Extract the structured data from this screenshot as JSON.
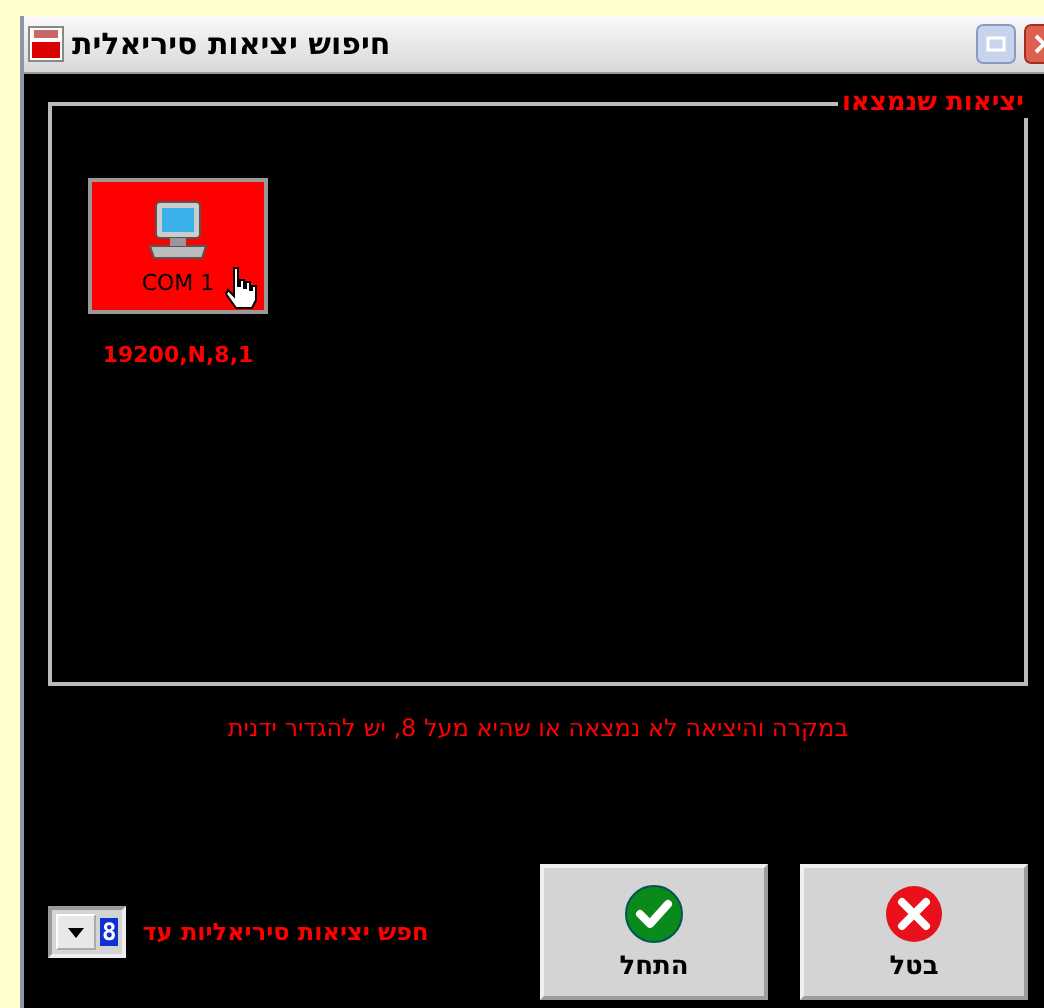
{
  "window": {
    "title": "חיפוש יציאות סיריאלית"
  },
  "found_ports": {
    "legend": "יציאות שנמצאו",
    "ports": [
      {
        "name": "COM 1",
        "settings": "19200,N,8,1",
        "selected": true
      }
    ]
  },
  "message": "במקרה והיציאה לא נמצאה או שהיא מעל 8, יש להגדיר ידנית",
  "search_limit": {
    "label": "חפש יציאות סיריאליות עד",
    "value": "8"
  },
  "buttons": [
    {
      "label": "בטל",
      "kind": "cancel"
    },
    {
      "label": "התחל",
      "kind": "start"
    }
  ]
}
